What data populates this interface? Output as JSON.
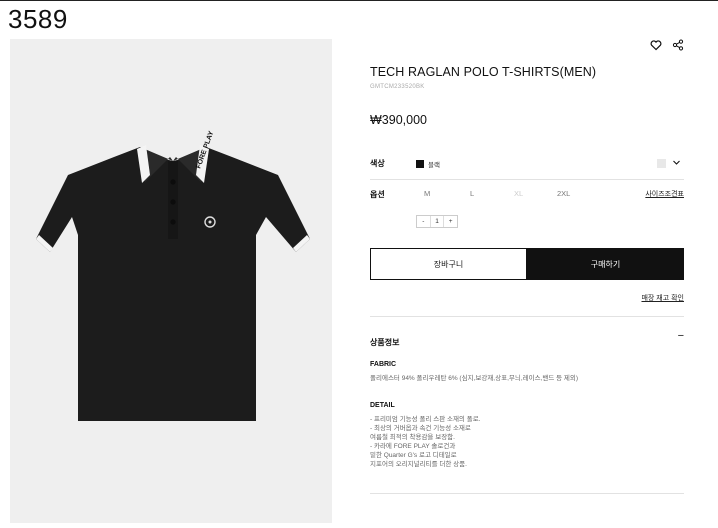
{
  "page": {
    "number": "3589"
  },
  "product": {
    "title": "TECH RAGLAN POLO T-SHIRTS(MEN)",
    "code": "GMTCM233520BK",
    "price": "₩390,000"
  },
  "image": {
    "brand_collar_text": "FORE PLAY"
  },
  "icons": {
    "wishlist": "heart-icon",
    "share": "share-icon",
    "color_dropdown": "chevron-down-icon"
  },
  "options": {
    "color_label": "색상",
    "color_name": "블랙",
    "option_label": "옵션",
    "sizes": [
      {
        "label": "M",
        "available": true
      },
      {
        "label": "L",
        "available": true
      },
      {
        "label": "XL",
        "available": false
      },
      {
        "label": "2XL",
        "available": true
      }
    ],
    "size_guide": "사이즈조견표",
    "quantity": {
      "minus": "-",
      "value": "1",
      "plus": "+"
    }
  },
  "actions": {
    "cart": "장바구니",
    "buy": "구매하기",
    "store_stock": "매장 재고 확인"
  },
  "details": {
    "header": "상품정보",
    "toggle": "−",
    "fabric_heading": "FABRIC",
    "fabric_text": "폴리에스터 94% 폴리우레탄 6% (심지,보강재,상표,무늬,레이스,밴드 등 제외)",
    "detail_heading": "DETAIL",
    "detail_lines": [
      "- 프리미엄 기능성 폴리 스판 소재의 폴로.",
      "- 최상의 거버옵과 속건 기능성 소재로",
      "  여름철 최적의 착용감을 보장함.",
      "- 카라에 FORE PLAY 솔로건과",
      "  밑한 Quarter G's 로고 디테일로",
      "  지포어의 오리지널리티를 더한 상품."
    ]
  },
  "colors": {
    "accent": "#111111",
    "image_bg": "#efefef",
    "divider": "#e2e2e2"
  }
}
